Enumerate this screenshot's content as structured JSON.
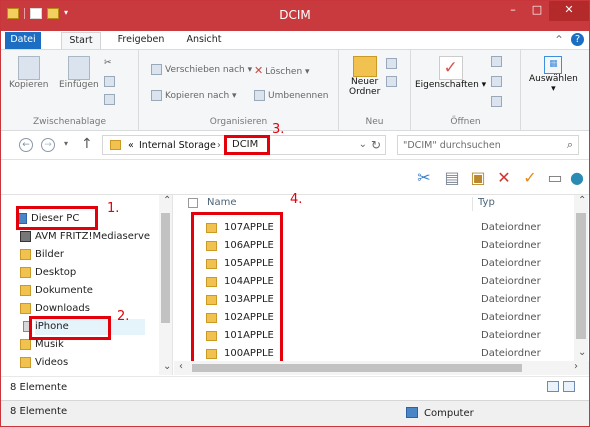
{
  "window": {
    "title": "DCIM"
  },
  "ribbon_tabs": [
    "Datei",
    "Start",
    "Freigeben",
    "Ansicht"
  ],
  "ribbon": {
    "clipboard_group": "Zwischenablage",
    "copy": "Kopieren",
    "paste": "Einfügen",
    "organize_group": "Organisieren",
    "move_to": "Verschieben nach",
    "copy_to": "Kopieren nach",
    "delete": "Löschen",
    "rename": "Umbenennen",
    "new_group": "Neu",
    "new_folder_line1": "Neuer",
    "new_folder_line2": "Ordner",
    "open_group": "Öffnen",
    "properties": "Eigenschaften",
    "select": "Auswählen"
  },
  "address": {
    "prefix": "«",
    "path": "Internal Storage",
    "current": "DCIM",
    "search_placeholder": "\"DCIM\" durchsuchen"
  },
  "annotations": [
    "1.",
    "2.",
    "3.",
    "4."
  ],
  "sidebar": [
    "Dieser PC",
    "AVM FRITZ!Mediaserve",
    "Bilder",
    "Desktop",
    "Dokumente",
    "Downloads",
    "iPhone",
    "Musik",
    "Videos"
  ],
  "list": {
    "col_name": "Name",
    "col_type": "Typ",
    "rows": [
      {
        "name": "107APPLE",
        "type": "Dateiordner"
      },
      {
        "name": "106APPLE",
        "type": "Dateiordner"
      },
      {
        "name": "105APPLE",
        "type": "Dateiordner"
      },
      {
        "name": "104APPLE",
        "type": "Dateiordner"
      },
      {
        "name": "103APPLE",
        "type": "Dateiordner"
      },
      {
        "name": "102APPLE",
        "type": "Dateiordner"
      },
      {
        "name": "101APPLE",
        "type": "Dateiordner"
      },
      {
        "name": "100APPLE",
        "type": "Dateiordner"
      }
    ]
  },
  "status": {
    "items_upper": "8 Elemente",
    "items_lower": "8 Elemente",
    "location": "Computer"
  },
  "colors": {
    "title_bar": "#c93a3e",
    "highlight": "#e3000b"
  },
  "icons": [
    "folder-icon",
    "cut-icon",
    "copy-icon",
    "paste-icon",
    "delete-icon",
    "check-icon",
    "rename-icon",
    "cloud-icon"
  ]
}
